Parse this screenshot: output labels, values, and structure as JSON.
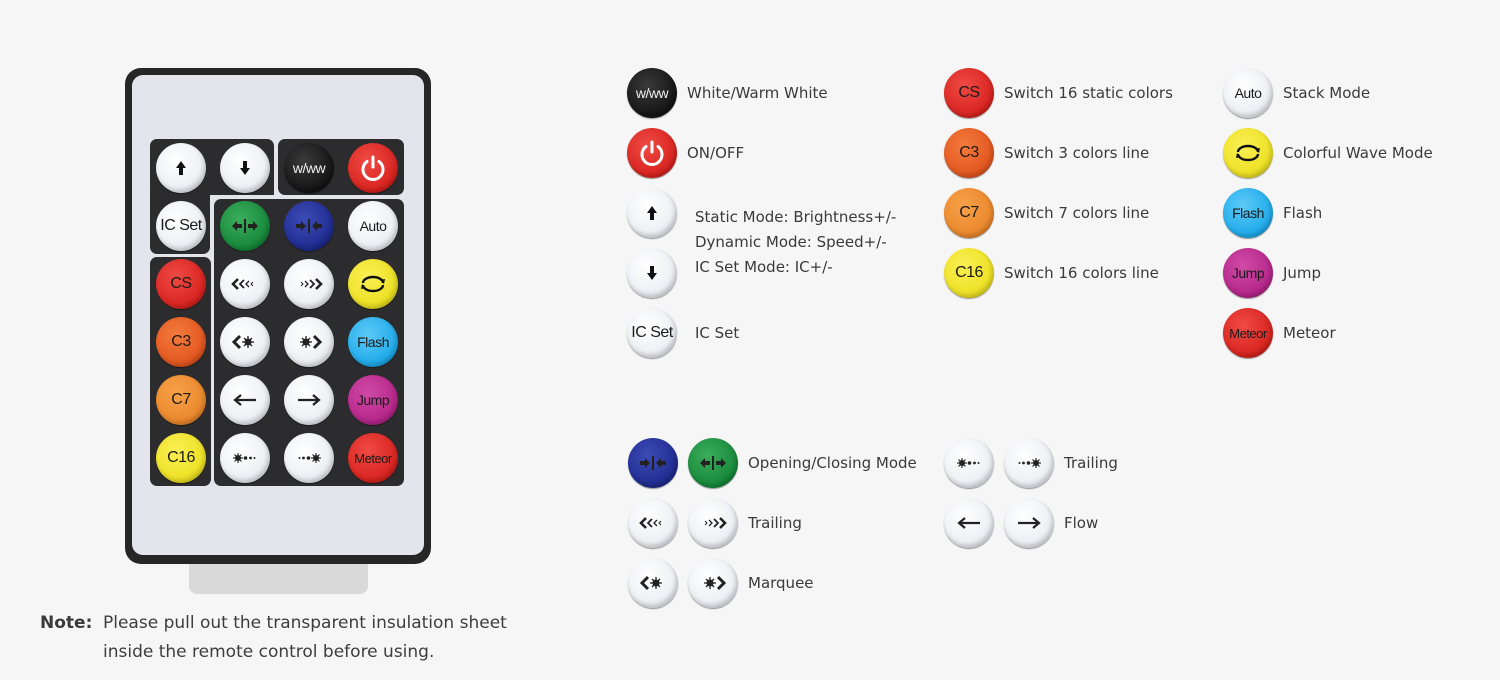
{
  "remote": {
    "buttons": {
      "up": "",
      "down": "",
      "ww": "w/ww",
      "power": "",
      "icset": "IC Set",
      "open": "",
      "close": "",
      "auto": "Auto",
      "cs": "CS",
      "trail_left": "",
      "trail_right": "",
      "wave": "",
      "c3": "C3",
      "marquee_left": "",
      "marquee_right": "",
      "flash": "Flash",
      "c7": "C7",
      "flow_left": "",
      "flow_right": "",
      "jump": "Jump",
      "c16": "C16",
      "dot_trail_left": "",
      "dot_trail_right": "",
      "meteor": "Meteor"
    }
  },
  "note": {
    "label": "Note:",
    "text": "Please pull out the transparent insulation sheet inside the remote control before using."
  },
  "legend": {
    "col1": [
      {
        "button": "w/ww",
        "label": "White/Warm White"
      },
      {
        "button": "power",
        "label": "ON/OFF"
      },
      {
        "button": "up",
        "label": ""
      },
      {
        "button": "down",
        "label": ""
      },
      {
        "button": "IC Set",
        "label": "IC Set"
      }
    ],
    "updown_lines": [
      "Static Mode: Brightness+/-",
      "Dynamic Mode: Speed+/-",
      "IC Set Mode: IC+/-"
    ],
    "col2": [
      {
        "button": "CS",
        "label": "Switch 16 static colors"
      },
      {
        "button": "C3",
        "label": "Switch 3 colors line"
      },
      {
        "button": "C7",
        "label": "Switch 7 colors line"
      },
      {
        "button": "C16",
        "label": "Switch 16 colors line"
      }
    ],
    "col3": [
      {
        "button": "Auto",
        "label": "Stack Mode"
      },
      {
        "button": "wave",
        "label": "Colorful Wave Mode"
      },
      {
        "button": "Flash",
        "label": "Flash"
      },
      {
        "button": "Jump",
        "label": "Jump"
      },
      {
        "button": "Meteor",
        "label": "Meteor"
      }
    ],
    "pairs_left": [
      {
        "buttons": [
          "close",
          "open"
        ],
        "label": "Opening/Closing Mode"
      },
      {
        "buttons": [
          "trail-left",
          "trail-right"
        ],
        "label": "Trailing"
      },
      {
        "buttons": [
          "marquee-left",
          "marquee-right"
        ],
        "label": "Marquee"
      }
    ],
    "pairs_right": [
      {
        "buttons": [
          "dot-trail-left",
          "dot-trail-right"
        ],
        "label": "Trailing"
      },
      {
        "buttons": [
          "flow-left",
          "flow-right"
        ],
        "label": "Flow"
      }
    ]
  },
  "colors": {
    "background": "#f6f6f6",
    "remote_body": "#262626",
    "remote_face": "#e4e5ec",
    "red": "#d8231f",
    "orange": "#e2561f",
    "amber": "#ea872b",
    "yellow": "#ece022",
    "green": "#16873a",
    "blue": "#1f2b8f",
    "cyan": "#1ea9ea",
    "magenta": "#b42589"
  }
}
